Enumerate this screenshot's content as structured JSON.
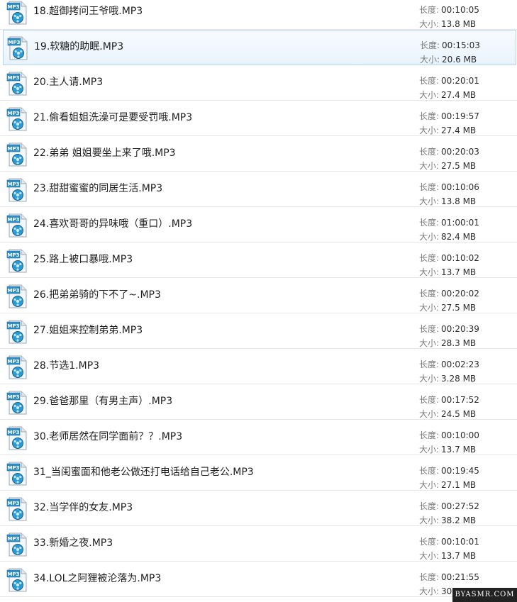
{
  "labels": {
    "duration": "长度:",
    "size": "大小:"
  },
  "icon": {
    "name": "mp3-file-icon",
    "badge_text": "MP3",
    "accent": "#2f8fc8"
  },
  "selected_index": 1,
  "files": [
    {
      "name": "18.超御拷问王爷哦.MP3",
      "duration": "00:10:05",
      "size": "13.8 MB"
    },
    {
      "name": "19.软糖的助眠.MP3",
      "duration": "00:15:03",
      "size": "20.6 MB"
    },
    {
      "name": "20.主人请.MP3",
      "duration": "00:20:01",
      "size": "27.4 MB"
    },
    {
      "name": "21.偷看姐姐洗澡可是要受罚哦.MP3",
      "duration": "00:19:57",
      "size": "27.4 MB"
    },
    {
      "name": "22.弟弟 姐姐要坐上来了哦.MP3",
      "duration": "00:20:03",
      "size": "27.5 MB"
    },
    {
      "name": "23.甜甜蜜蜜的同居生活.MP3",
      "duration": "00:10:06",
      "size": "13.8 MB"
    },
    {
      "name": "24.喜欢哥哥的异味哦（重口）.MP3",
      "duration": "01:00:01",
      "size": "82.4 MB"
    },
    {
      "name": "25.路上被口暴哦.MP3",
      "duration": "00:10:02",
      "size": "13.7 MB"
    },
    {
      "name": "26.把弟弟骑的下不了~.MP3",
      "duration": "00:20:02",
      "size": "27.5 MB"
    },
    {
      "name": "27.姐姐来控制弟弟.MP3",
      "duration": "00:20:39",
      "size": "28.3 MB"
    },
    {
      "name": "28.节选1.MP3",
      "duration": "00:02:23",
      "size": "3.28 MB"
    },
    {
      "name": "29.爸爸那里（有男主声）.MP3",
      "duration": "00:17:52",
      "size": "24.5 MB"
    },
    {
      "name": "30.老师居然在同学面前？？.MP3",
      "duration": "00:10:00",
      "size": "13.7 MB"
    },
    {
      "name": "31_当闺蜜面和他老公做还打电话给自己老公.MP3",
      "duration": "00:19:45",
      "size": "27.1 MB"
    },
    {
      "name": "32.当学伴的女友.MP3",
      "duration": "00:27:52",
      "size": "38.2 MB"
    },
    {
      "name": "33.新婚之夜.MP3",
      "duration": "00:10:01",
      "size": "13.7 MB"
    },
    {
      "name": "34.LOL之阿狸被沦落为.MP3",
      "duration": "00:21:55",
      "size": "30."
    }
  ],
  "watermark": "BYASMR.COM"
}
